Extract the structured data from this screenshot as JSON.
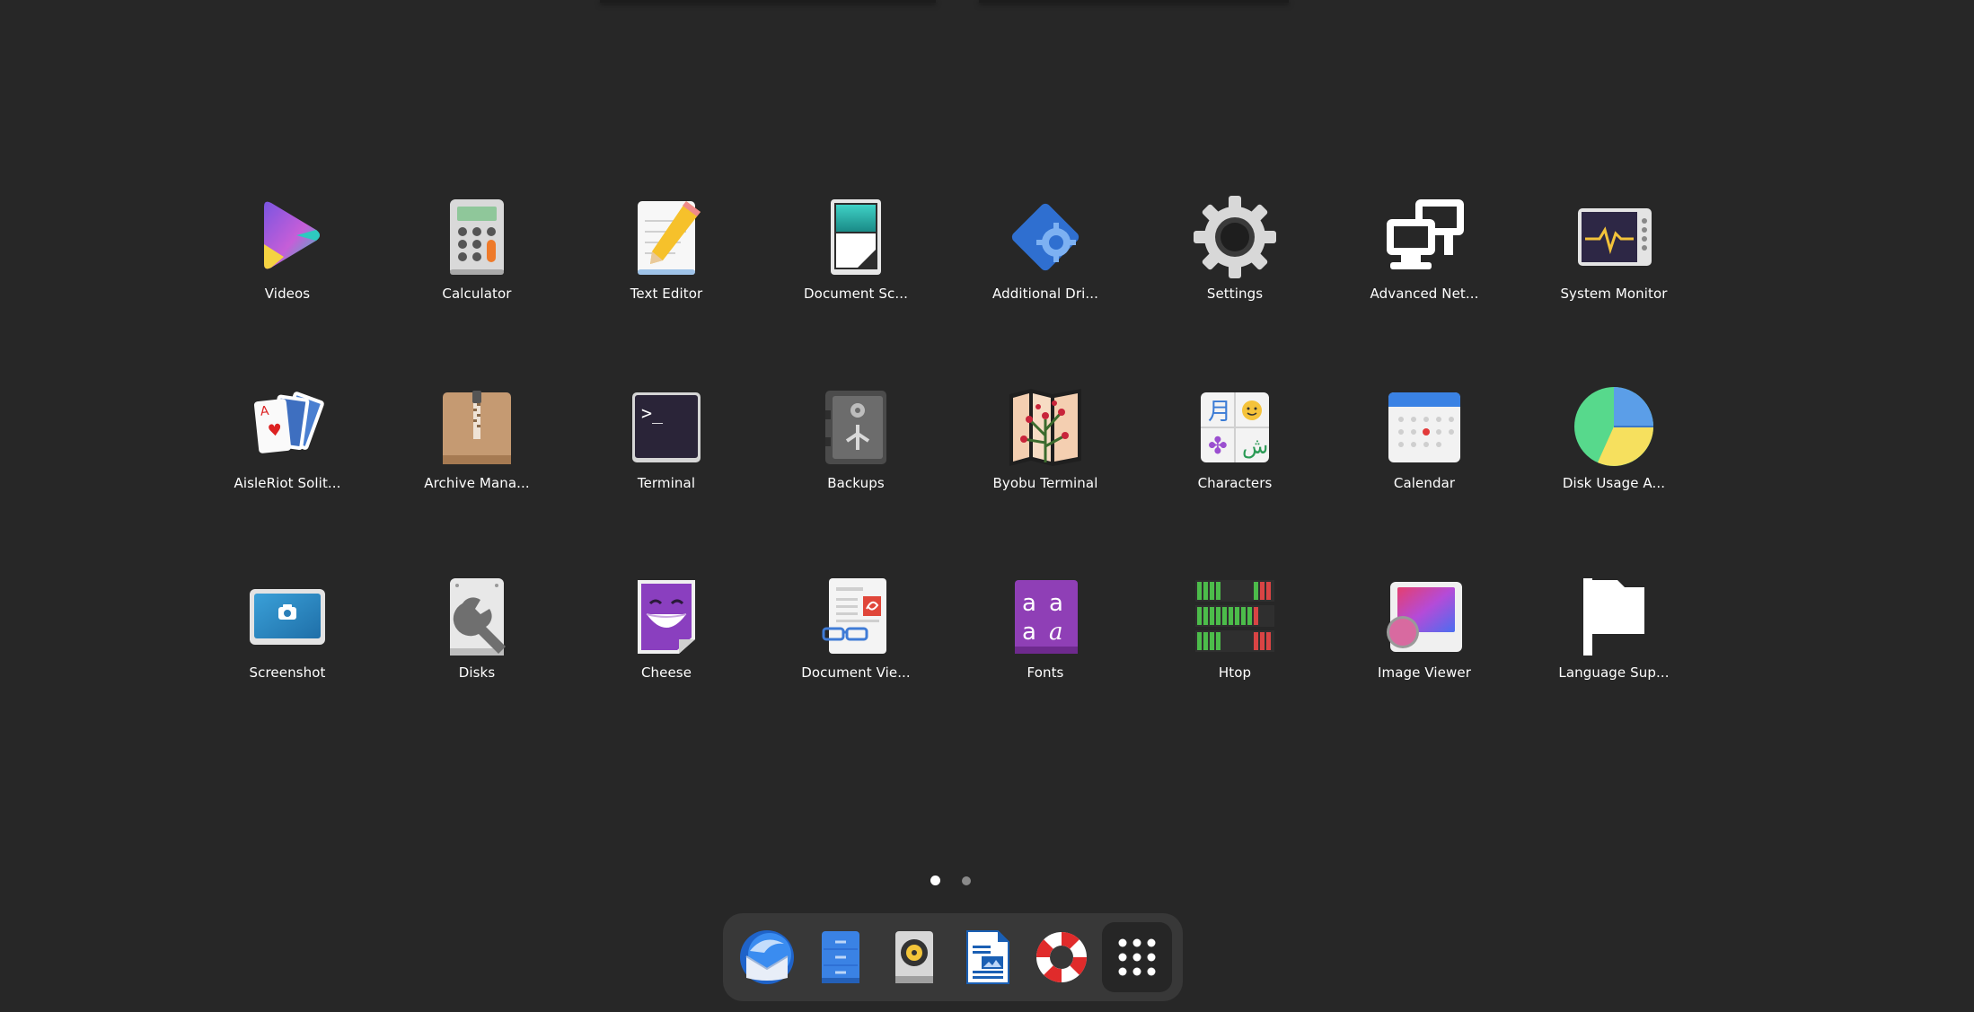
{
  "apps": [
    {
      "label": "Videos",
      "icon": "videos-icon"
    },
    {
      "label": "Calculator",
      "icon": "calculator-icon"
    },
    {
      "label": "Text Editor",
      "icon": "text-editor-icon"
    },
    {
      "label": "Document Sc...",
      "icon": "document-scanner-icon"
    },
    {
      "label": "Additional Dri...",
      "icon": "additional-drivers-icon"
    },
    {
      "label": "Settings",
      "icon": "settings-gear-icon"
    },
    {
      "label": "Advanced Net...",
      "icon": "advanced-network-icon"
    },
    {
      "label": "System Monitor",
      "icon": "system-monitor-icon"
    },
    {
      "label": "AisleRiot Solit...",
      "icon": "aisleriot-cards-icon"
    },
    {
      "label": "Archive Mana...",
      "icon": "archive-box-icon"
    },
    {
      "label": "Terminal",
      "icon": "terminal-icon"
    },
    {
      "label": "Backups",
      "icon": "backups-safe-icon"
    },
    {
      "label": "Byobu Terminal",
      "icon": "byobu-map-icon"
    },
    {
      "label": "Characters",
      "icon": "characters-icon"
    },
    {
      "label": "Calendar",
      "icon": "calendar-icon"
    },
    {
      "label": "Disk Usage A...",
      "icon": "disk-usage-pie-icon"
    },
    {
      "label": "Screenshot",
      "icon": "screenshot-camera-icon"
    },
    {
      "label": "Disks",
      "icon": "disks-wrench-icon"
    },
    {
      "label": "Cheese",
      "icon": "cheese-face-icon"
    },
    {
      "label": "Document Vie...",
      "icon": "document-viewer-icon"
    },
    {
      "label": "Fonts",
      "icon": "fonts-icon"
    },
    {
      "label": "Htop",
      "icon": "htop-bars-icon"
    },
    {
      "label": "Image Viewer",
      "icon": "image-viewer-icon"
    },
    {
      "label": "Language Sup...",
      "icon": "language-flag-icon"
    }
  ],
  "pager": {
    "pages": 2,
    "current": 1
  },
  "dock": [
    {
      "name": "thunderbird",
      "icon": "thunderbird-mail-icon"
    },
    {
      "name": "files",
      "icon": "files-cabinet-icon"
    },
    {
      "name": "rhythmbox",
      "icon": "rhythmbox-speaker-icon"
    },
    {
      "name": "libreoffice-writer",
      "icon": "writer-document-icon"
    },
    {
      "name": "help",
      "icon": "help-lifebuoy-icon"
    },
    {
      "name": "show-apps",
      "icon": "show-apps-grid-icon"
    }
  ],
  "colors": {
    "background": "#272727",
    "dock": "#383838",
    "label": "#ffffff"
  }
}
